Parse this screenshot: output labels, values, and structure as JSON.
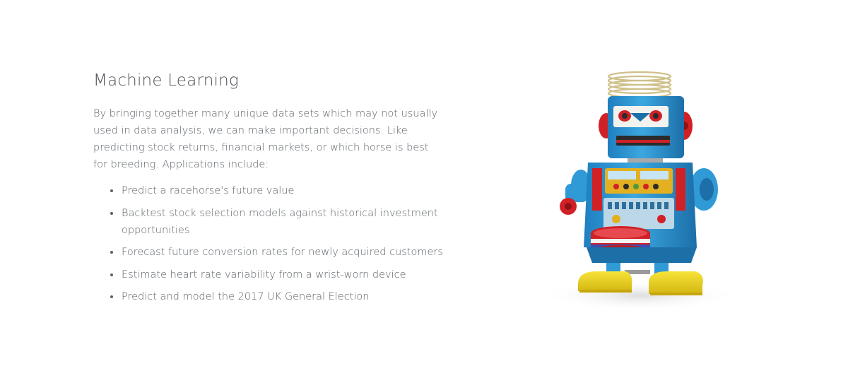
{
  "section": {
    "title": "Machine Learning",
    "intro": "By bringing together many unique data sets which may not usually used in data analysis, we can make important decisions. Like predicting stock returns, financial markets, or which horse is best for breeding. Applications include:",
    "applications": [
      "Predict a racehorse's future value",
      "Backtest stock selection models against historical investment opportunities",
      "Forecast future conversion rates for newly acquired customers",
      "Estimate heart rate variability from a wrist-worn device",
      "Predict and model the 2017 UK General Election"
    ],
    "image": {
      "icon": "toy-robot-illustration",
      "colors": {
        "body": "#2f9ad6",
        "trim": "#d9262c",
        "feet": "#f2d81c",
        "spring": "#d8c98f"
      }
    }
  }
}
